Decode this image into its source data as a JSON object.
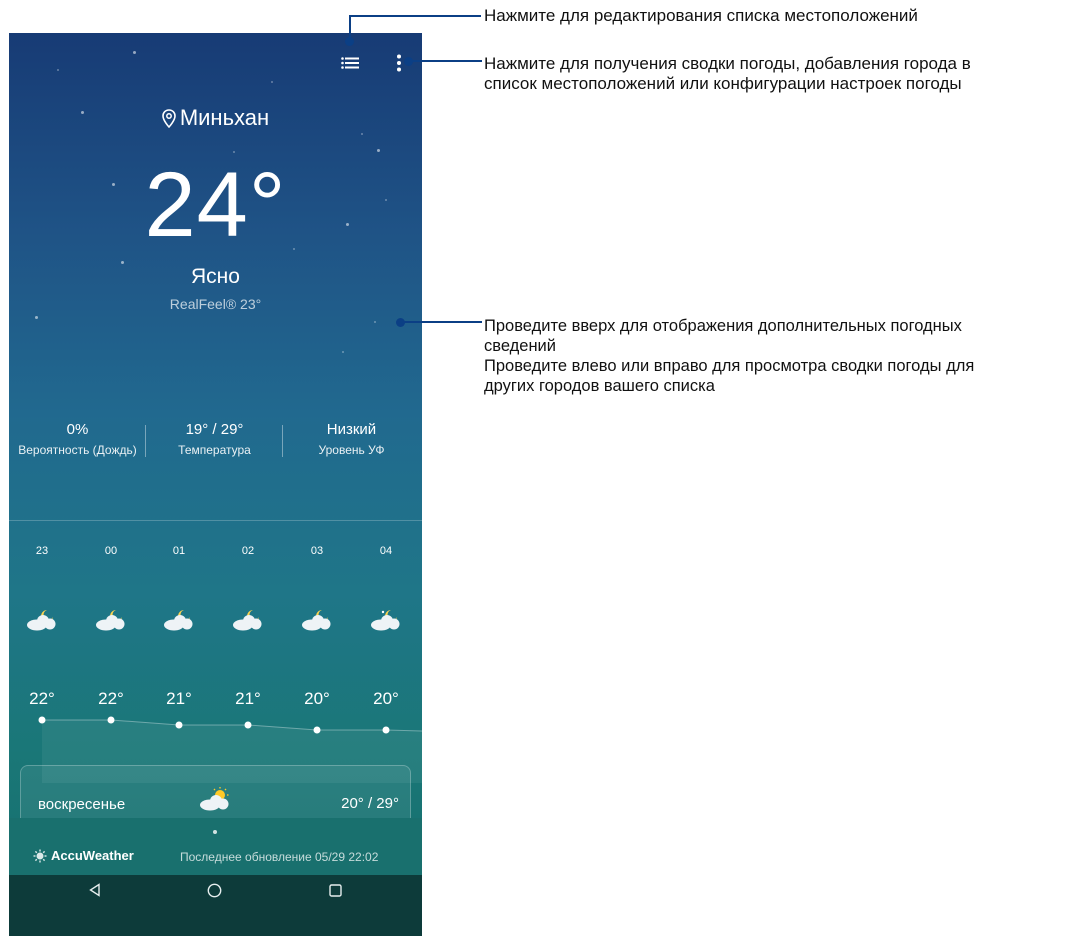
{
  "weather": {
    "location": "Миньхан",
    "temperature": "24°",
    "condition": "Ясно",
    "realfeel": "RealFeel® 23°",
    "stats": [
      {
        "value": "0%",
        "label": "Вероятность (Дождь)"
      },
      {
        "value": "19° / 29°",
        "label": "Температура"
      },
      {
        "value": "Низкий",
        "label": "Уровень УФ"
      }
    ],
    "hourly": [
      {
        "hour": "23",
        "temp": "22°"
      },
      {
        "hour": "00",
        "temp": "22°"
      },
      {
        "hour": "01",
        "temp": "21°"
      },
      {
        "hour": "02",
        "temp": "21°"
      },
      {
        "hour": "03",
        "temp": "20°"
      },
      {
        "hour": "04",
        "temp": "20°"
      }
    ],
    "daily": {
      "day": "воскресенье",
      "range": "20° / 29°"
    },
    "brand": "AccuWeather",
    "last_updated": "Последнее обновление 05/29 22:02"
  },
  "toolbar": {
    "list_icon": "list-icon",
    "more_icon": "more-vertical-icon"
  },
  "navbar": {
    "back_icon": "back-icon",
    "home_icon": "home-icon",
    "recents_icon": "recents-icon"
  },
  "annotations": {
    "edit_list": "Нажмите для редактирования списка местоположений",
    "menu_line1": "Нажмите для получения сводки погоды, добавления города в",
    "menu_line2": "список местоположений или конфигурации настроек погоды",
    "swipe_line1": "Проведите вверх для отображения дополнительных погодных",
    "swipe_line2": "сведений",
    "swipe_line3": "Проведите влево или вправо для просмотра сводки погоды для",
    "swipe_line4": "других городов вашего списка"
  },
  "colors": {
    "accent_line": "#0b3f85",
    "sky_top": "#173b75",
    "sky_bottom": "#156c6b"
  }
}
